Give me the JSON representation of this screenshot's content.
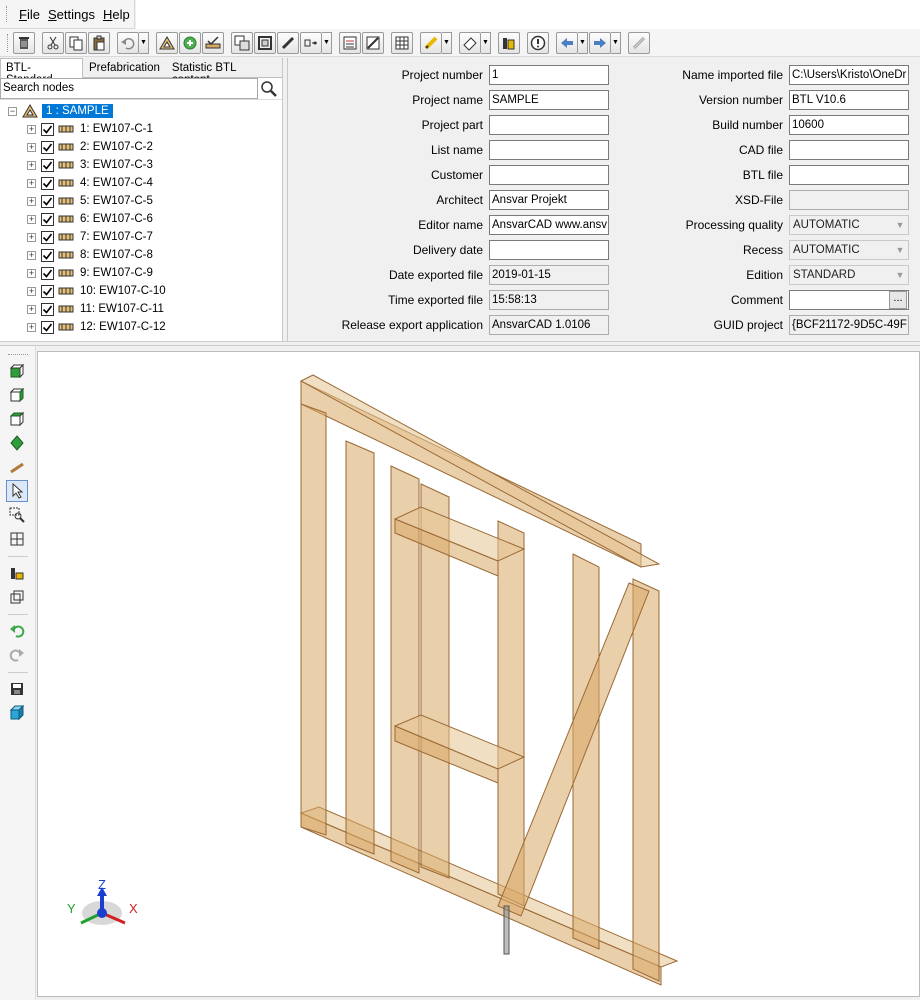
{
  "menu": {
    "items": [
      {
        "accel": "F",
        "rest": "ile"
      },
      {
        "accel": "S",
        "rest": "ettings"
      },
      {
        "accel": "H",
        "rest": "elp"
      }
    ]
  },
  "tabs": [
    "BTL-Standard",
    "Prefabrication",
    "Statistic BTL content"
  ],
  "search": {
    "value": "Search nodes"
  },
  "tree": {
    "root": "1 : SAMPLE",
    "items": [
      "1: EW107-C-1",
      "2: EW107-C-2",
      "3: EW107-C-3",
      "4: EW107-C-4",
      "5: EW107-C-5",
      "6: EW107-C-6",
      "7: EW107-C-7",
      "8: EW107-C-8",
      "9: EW107-C-9",
      "10: EW107-C-10",
      "11: EW107-C-11",
      "12: EW107-C-12"
    ]
  },
  "props_left": [
    {
      "label": "Project number",
      "value": "1"
    },
    {
      "label": "Project name",
      "value": "SAMPLE"
    },
    {
      "label": "Project part",
      "value": ""
    },
    {
      "label": "List name",
      "value": ""
    },
    {
      "label": "Customer",
      "value": ""
    },
    {
      "label": "Architect",
      "value": "Ansvar Projekt"
    },
    {
      "label": "Editor name",
      "value": "AnsvarCAD www.ansv"
    },
    {
      "label": "Delivery date",
      "value": ""
    },
    {
      "label": "Date exported file",
      "value": "2019-01-15"
    },
    {
      "label": "Time exported file",
      "value": "15:58:13"
    },
    {
      "label": "Release export application",
      "value": "AnsvarCAD 1.0106"
    }
  ],
  "props_right": [
    {
      "label": "Name imported file",
      "value": "C:\\Users\\Kristo\\OneDr"
    },
    {
      "label": "Version number",
      "value": "BTL V10.6"
    },
    {
      "label": "Build number",
      "value": "10600"
    },
    {
      "label": "CAD file",
      "value": ""
    },
    {
      "label": "BTL file",
      "value": ""
    },
    {
      "label": "XSD-File",
      "value": ""
    },
    {
      "label": "Processing quality",
      "value": "AUTOMATIC"
    },
    {
      "label": "Recess",
      "value": "AUTOMATIC"
    },
    {
      "label": "Edition",
      "value": "STANDARD"
    },
    {
      "label": "Comment",
      "value": ""
    },
    {
      "label": "GUID project",
      "value": "{BCF21172-9D5C-49F"
    }
  ],
  "comment_button": "...",
  "axes": {
    "z": "Z",
    "y": "Y",
    "x": "X"
  },
  "colors": {
    "selection": "#0078d7",
    "wood": "#d9a866",
    "wood_dark": "#b07a3a"
  }
}
